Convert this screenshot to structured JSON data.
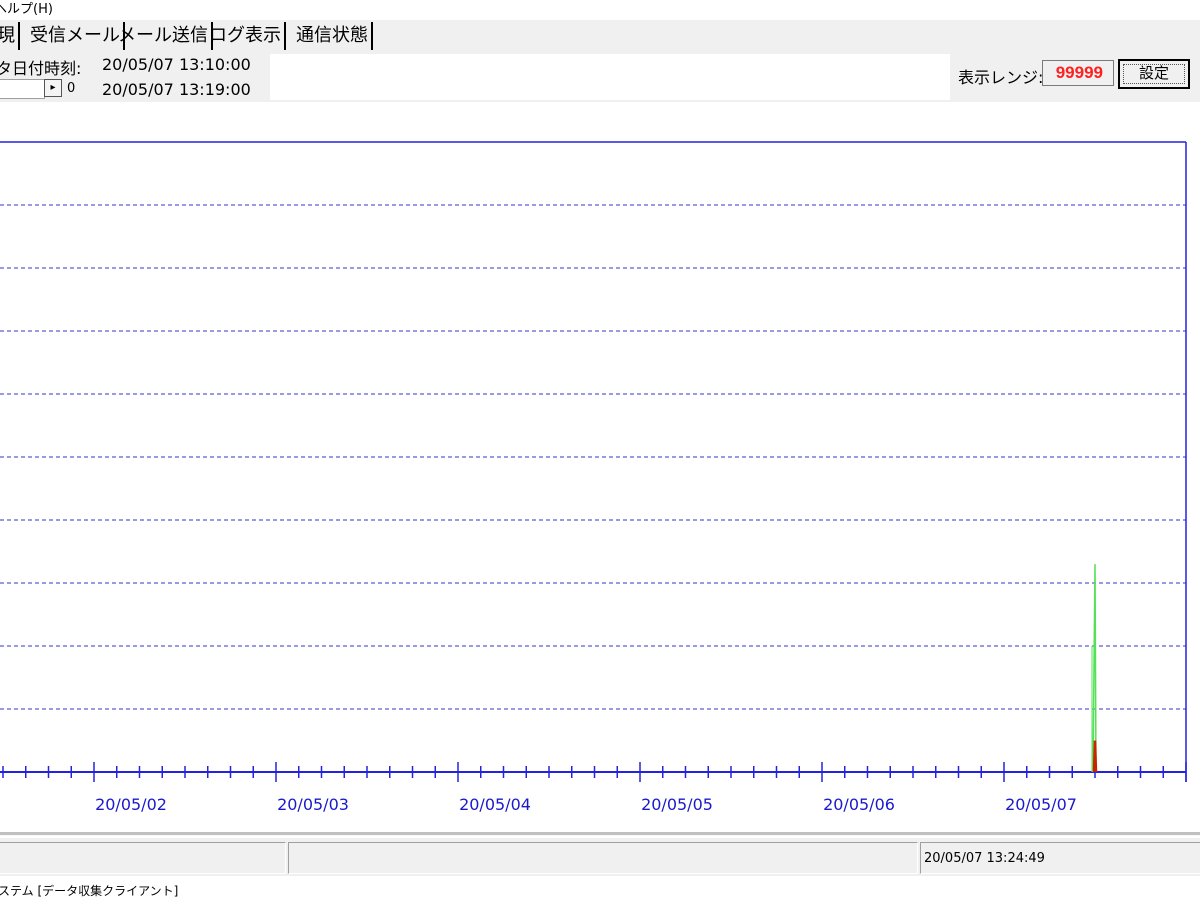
{
  "menu": {
    "help_label": "ヘルプ(H)"
  },
  "tabs": [
    {
      "label": "現"
    },
    {
      "label": "受信メール"
    },
    {
      "label": "メール送信"
    },
    {
      "label": "ログ表示"
    },
    {
      "label": "通信状態"
    }
  ],
  "info": {
    "date_label": "タ日付時刻:",
    "start_time": "20/05/07 13:10:00",
    "end_time": "20/05/07 13:19:00",
    "nav_value": "0",
    "nav_arrow": "▸"
  },
  "range": {
    "label": "表示レンジ:",
    "value": "99999",
    "set_button": "設定"
  },
  "chart_data": {
    "type": "line",
    "x_tick_labels": [
      "20/05/02",
      "20/05/03",
      "20/05/04",
      "20/05/05",
      "20/05/06",
      "20/05/07"
    ],
    "gridlines": "horizontal dashed",
    "series": [
      {
        "color": "#55e055",
        "spike_at": "20/05/07",
        "relative_peak": 0.33
      },
      {
        "color": "#cc2200",
        "spike_at": "20/05/07",
        "relative_peak": 0.05
      }
    ],
    "colors": {
      "axis": "#2323dd",
      "grid": "#3333cc",
      "tick_label": "#1a1acc"
    }
  },
  "status": {
    "time": "20/05/07 13:24:49"
  },
  "taskbar": {
    "title": "ステム [データ収集クライアント]"
  }
}
